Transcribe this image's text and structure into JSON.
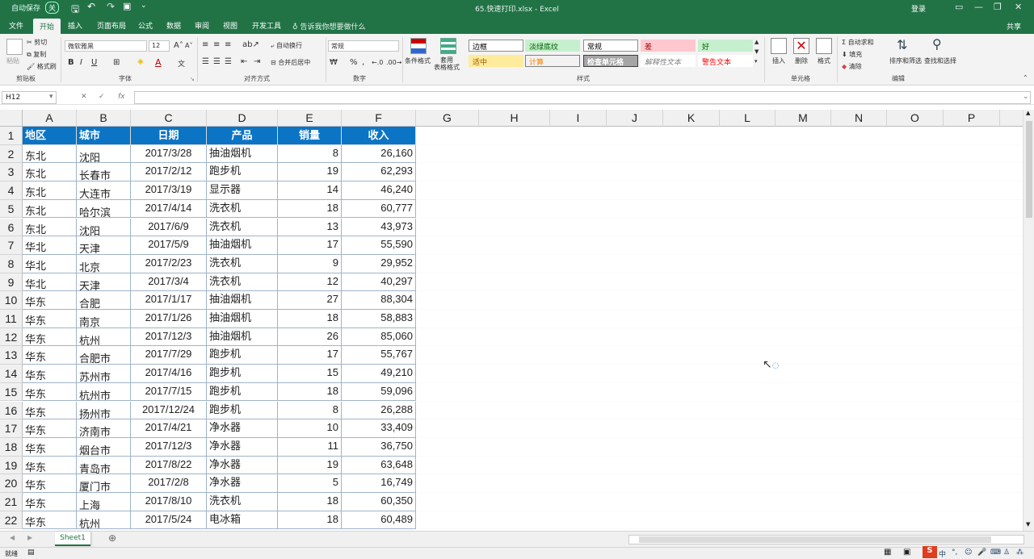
{
  "window": {
    "autosave": "自动保存",
    "autosave_state": "关",
    "title": "65.快速打印.xlsx  -  Excel",
    "login": "登录"
  },
  "tabs": [
    "文件",
    "开始",
    "插入",
    "页面布局",
    "公式",
    "数据",
    "审阅",
    "视图",
    "开发工具"
  ],
  "active_tab": "开始",
  "tell_me": "告诉我你想要做什么",
  "share": "共享",
  "ribbon": {
    "clipboard": {
      "paste": "粘贴",
      "cut": "剪切",
      "copy": "复制",
      "format_painter": "格式刷",
      "label": "剪贴板"
    },
    "font": {
      "name": "微软雅黑",
      "size": "12",
      "label": "字体"
    },
    "alignment": {
      "wrap": "自动换行",
      "merge": "合并后居中",
      "label": "对齐方式"
    },
    "number": {
      "format": "常规",
      "label": "数字"
    },
    "styles": {
      "conditional": "条件格式",
      "table": "套用\n表格格式",
      "cells": [
        {
          "text": "边框",
          "bg": "#ffffff",
          "color": "#000000",
          "border": "#8c8c8c"
        },
        {
          "text": "淡绿底纹",
          "bg": "#c6efce",
          "color": "#006100",
          "border": "#c6efce"
        },
        {
          "text": "常规",
          "bg": "#ffffff",
          "color": "#000000",
          "border": "#8c8c8c"
        },
        {
          "text": "差",
          "bg": "#ffc7ce",
          "color": "#9c0006",
          "border": "#ffc7ce"
        },
        {
          "text": "好",
          "bg": "#c6efce",
          "color": "#006100",
          "border": "#c6efce"
        },
        {
          "text": "适中",
          "bg": "#ffeb9c",
          "color": "#9c5700",
          "border": "#ffeb9c"
        },
        {
          "text": "计算",
          "bg": "#f2f2f2",
          "color": "#fa7d00",
          "border": "#7f7f7f"
        },
        {
          "text": "检查单元格",
          "bg": "#a5a5a5",
          "color": "#ffffff",
          "border": "#3f3f3f"
        },
        {
          "text": "解释性文本",
          "bg": "#ffffff",
          "color": "#7f7f7f",
          "border": "#ffffff"
        },
        {
          "text": "警告文本",
          "bg": "#ffffff",
          "color": "#ff0000",
          "border": "#ffffff"
        }
      ],
      "label": "样式"
    },
    "cells_group": {
      "insert": "插入",
      "delete": "删除",
      "format": "格式",
      "label": "单元格"
    },
    "editing": {
      "autosum": "自动求和",
      "fill": "填充",
      "clear": "清除",
      "sort": "排序和筛选",
      "find": "查找和选择",
      "label": "编辑"
    }
  },
  "formula_bar": {
    "name_box": "H12",
    "fx": "fx",
    "value": ""
  },
  "columns": [
    "A",
    "B",
    "C",
    "D",
    "E",
    "F",
    "G",
    "H",
    "I",
    "J",
    "K",
    "L",
    "M",
    "N",
    "O",
    "P",
    ""
  ],
  "rows": [
    "1",
    "2",
    "3",
    "4",
    "5",
    "6",
    "7",
    "8",
    "9",
    "10",
    "11",
    "12",
    "13",
    "14",
    "15",
    "16",
    "17",
    "18",
    "19",
    "20",
    "21",
    "22"
  ],
  "table": {
    "headers": [
      "地区",
      "城市",
      "日期",
      "产品",
      "销量",
      "收入"
    ],
    "data": [
      [
        "东北",
        "沈阳",
        "2017/3/28",
        "抽油烟机",
        "8",
        "26,160"
      ],
      [
        "东北",
        "长春市",
        "2017/2/12",
        "跑步机",
        "19",
        "62,293"
      ],
      [
        "东北",
        "大连市",
        "2017/3/19",
        "显示器",
        "14",
        "46,240"
      ],
      [
        "东北",
        "哈尔滨",
        "2017/4/14",
        "洗衣机",
        "18",
        "60,777"
      ],
      [
        "东北",
        "沈阳",
        "2017/6/9",
        "洗衣机",
        "13",
        "43,973"
      ],
      [
        "华北",
        "天津",
        "2017/5/9",
        "抽油烟机",
        "17",
        "55,590"
      ],
      [
        "华北",
        "北京",
        "2017/2/23",
        "洗衣机",
        "9",
        "29,952"
      ],
      [
        "华北",
        "天津",
        "2017/3/4",
        "洗衣机",
        "12",
        "40,297"
      ],
      [
        "华东",
        "合肥",
        "2017/1/17",
        "抽油烟机",
        "27",
        "88,304"
      ],
      [
        "华东",
        "南京",
        "2017/1/26",
        "抽油烟机",
        "18",
        "58,883"
      ],
      [
        "华东",
        "杭州",
        "2017/12/3",
        "抽油烟机",
        "26",
        "85,060"
      ],
      [
        "华东",
        "合肥市",
        "2017/7/29",
        "跑步机",
        "17",
        "55,767"
      ],
      [
        "华东",
        "苏州市",
        "2017/4/16",
        "跑步机",
        "15",
        "49,210"
      ],
      [
        "华东",
        "杭州市",
        "2017/7/15",
        "跑步机",
        "18",
        "59,096"
      ],
      [
        "华东",
        "扬州市",
        "2017/12/24",
        "跑步机",
        "8",
        "26,288"
      ],
      [
        "华东",
        "济南市",
        "2017/4/21",
        "净水器",
        "10",
        "33,409"
      ],
      [
        "华东",
        "烟台市",
        "2017/12/3",
        "净水器",
        "11",
        "36,750"
      ],
      [
        "华东",
        "青岛市",
        "2017/8/22",
        "净水器",
        "19",
        "63,648"
      ],
      [
        "华东",
        "厦门市",
        "2017/2/8",
        "净水器",
        "5",
        "16,749"
      ],
      [
        "华东",
        "上海",
        "2017/8/10",
        "洗衣机",
        "18",
        "60,350"
      ],
      [
        "华东",
        "杭州",
        "2017/5/24",
        "电冰箱",
        "18",
        "60,489"
      ]
    ]
  },
  "sheets": [
    "Sheet1"
  ],
  "status": {
    "ready": "就绪"
  },
  "colors": {
    "accent": "#217346",
    "header_fill": "#0b74c4"
  }
}
